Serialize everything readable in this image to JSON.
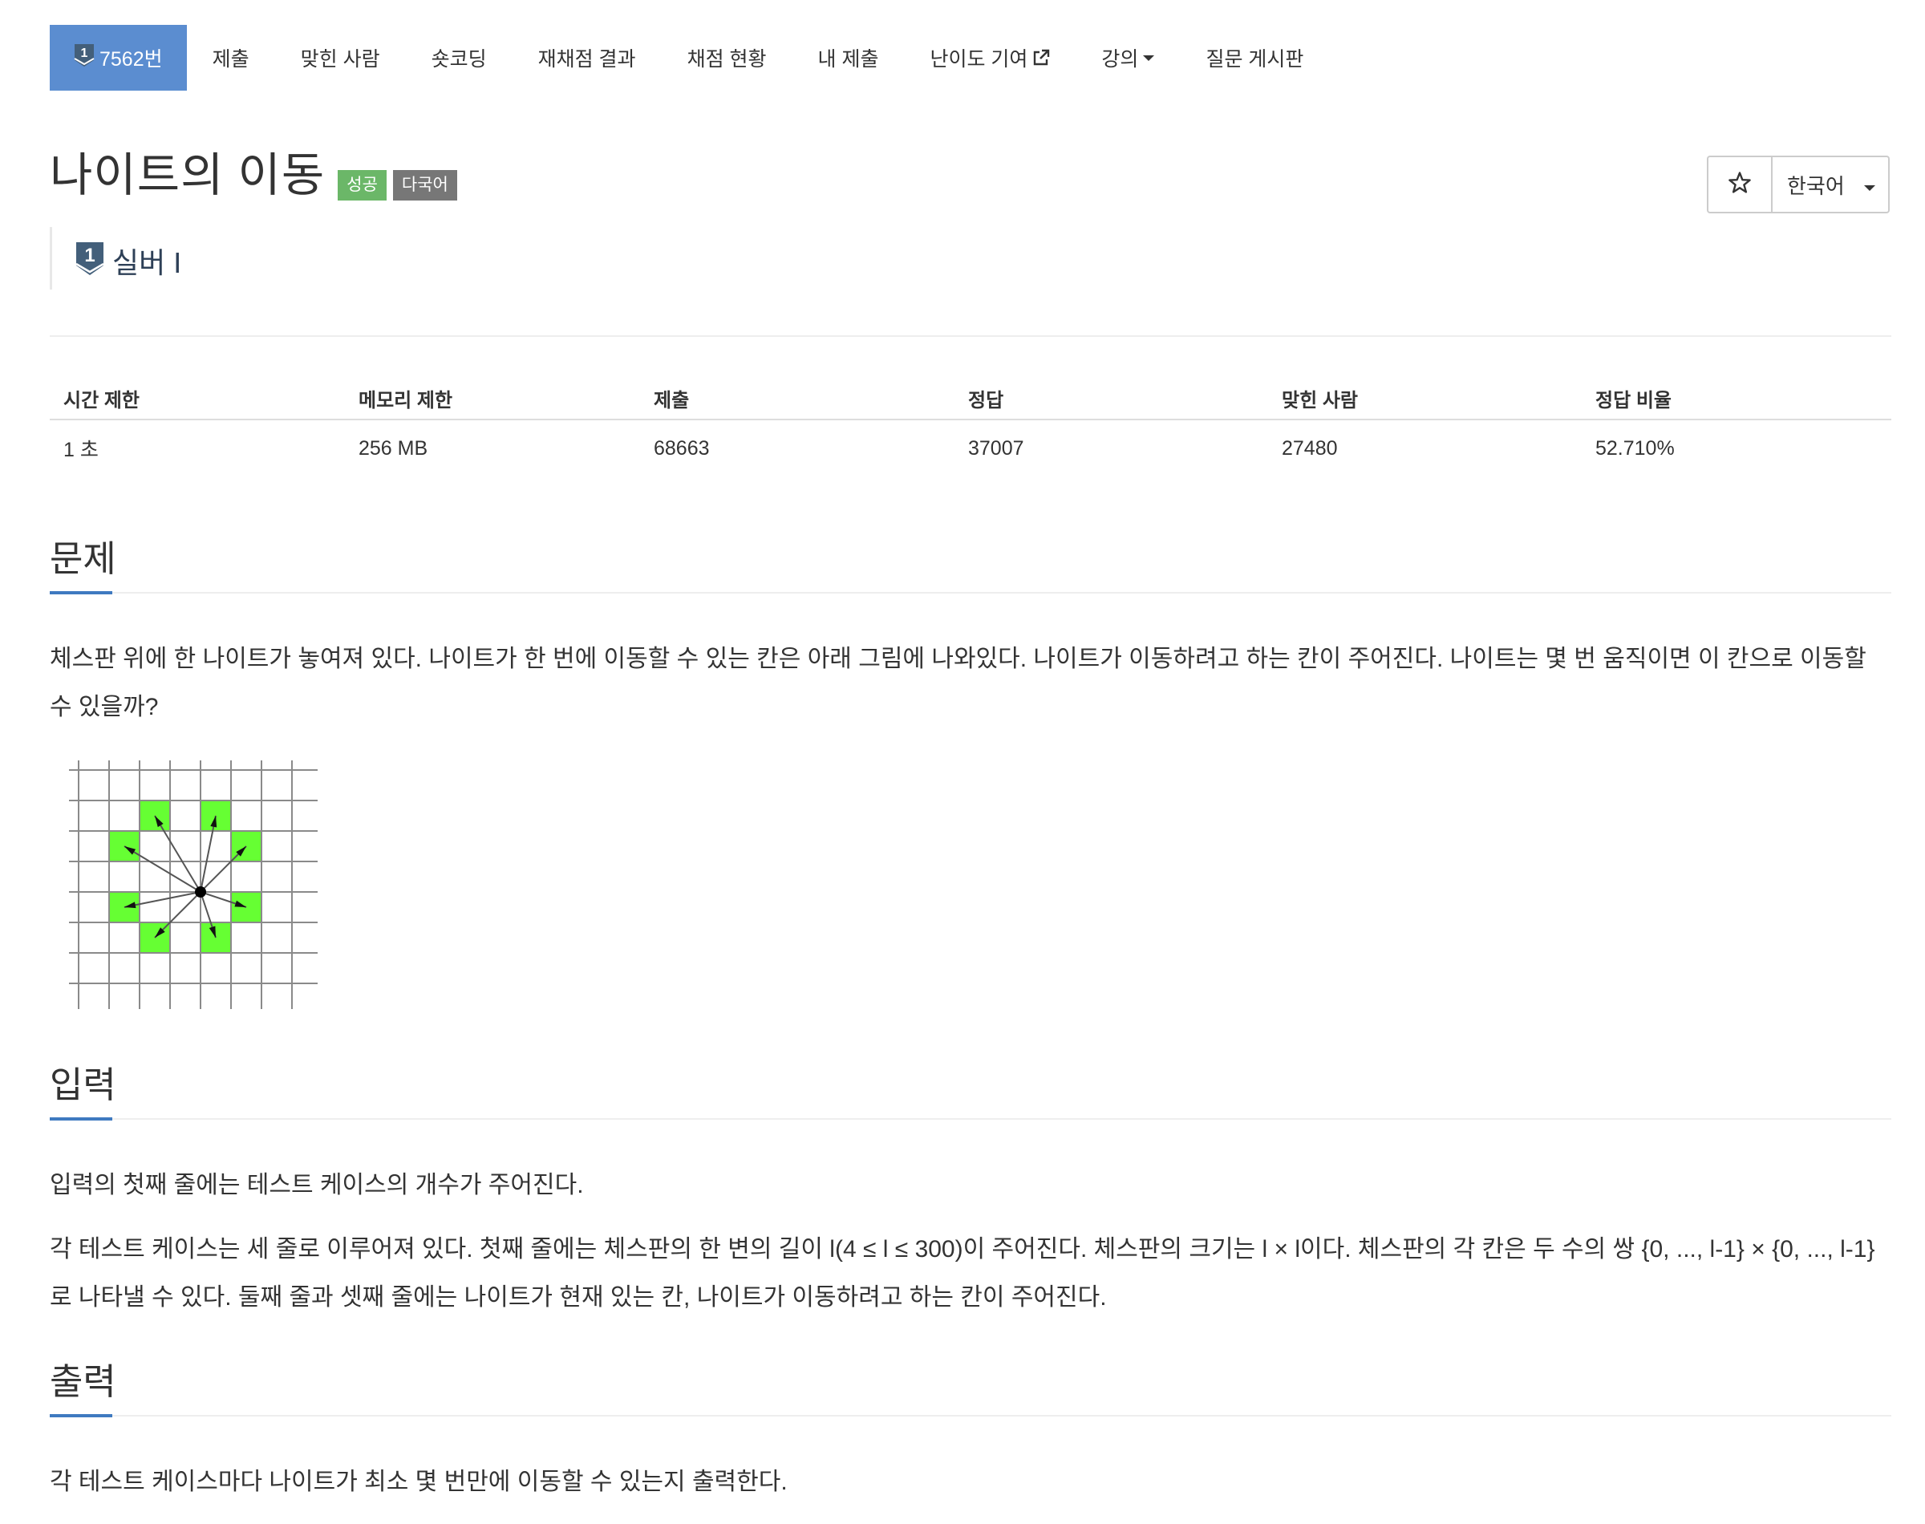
{
  "nav": {
    "problem_tab": {
      "tier_num": "1",
      "label": "7562번"
    },
    "items": [
      {
        "label": "제출"
      },
      {
        "label": "맞힌 사람"
      },
      {
        "label": "숏코딩"
      },
      {
        "label": "재채점 결과"
      },
      {
        "label": "채점 현황"
      },
      {
        "label": "내 제출"
      },
      {
        "label": "난이도 기여",
        "icon": "external-link-icon"
      },
      {
        "label": "강의",
        "icon": "caret-down-icon"
      },
      {
        "label": "질문 게시판"
      }
    ]
  },
  "problem": {
    "title": "나이트의 이동",
    "badges": {
      "success": "성공",
      "multilang": "다국어"
    },
    "tier": {
      "num": "1",
      "label": "실버 I",
      "color": "#435f7a"
    }
  },
  "language_button": {
    "label": "한국어",
    "star_icon": "star-outline-icon"
  },
  "info_table": {
    "headers": [
      "시간 제한",
      "메모리 제한",
      "제출",
      "정답",
      "맞힌 사람",
      "정답 비율"
    ],
    "values": [
      "1 초",
      "256 MB",
      "68663",
      "37007",
      "27480",
      "52.710%"
    ]
  },
  "sections": {
    "problem": {
      "title": "문제",
      "text": "체스판 위에 한 나이트가 놓여져 있다. 나이트가 한 번에 이동할 수 있는 칸은 아래 그림에 나와있다. 나이트가 이동하려고 하는 칸이 주어진다. 나이트는 몇 번 움직이면 이 칸으로 이동할 수 있을까?"
    },
    "input": {
      "title": "입력",
      "p1": "입력의 첫째 줄에는 테스트 케이스의 개수가 주어진다.",
      "p2": "각 테스트 케이스는 세 줄로 이루어져 있다. 첫째 줄에는 체스판의 한 변의 길이 l(4 ≤ l ≤ 300)이 주어진다. 체스판의 크기는 l × l이다. 체스판의 각 칸은 두 수의 쌍 {0, ..., l-1} × {0, ..., l-1}로 나타낼 수 있다. 둘째 줄과 셋째 줄에는 나이트가 현재 있는 칸, 나이트가 이동하려고 하는 칸이 주어진다."
    },
    "output": {
      "title": "출력",
      "text": "각 테스트 케이스마다 나이트가 최소 몇 번만에 이동할 수 있는지 출력한다."
    }
  },
  "colors": {
    "nav_active": "#5b8dd0",
    "badge_success": "#6bb768",
    "badge_multi": "#777777",
    "section_accent": "#3f7ac0",
    "knight_cell": "#66ff33"
  }
}
